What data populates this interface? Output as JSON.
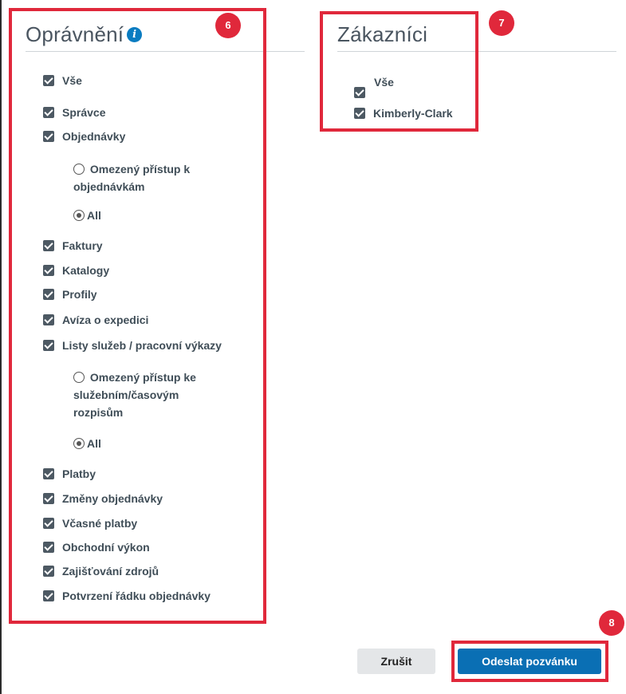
{
  "permissions": {
    "title": "Oprávnění",
    "badge": "6",
    "items": [
      {
        "type": "checkbox",
        "label": "Vše"
      },
      {
        "type": "checkbox",
        "label": "Správce"
      },
      {
        "type": "checkbox",
        "label": "Objednávky"
      },
      {
        "type": "radio",
        "label": "Omezený přístup k objednávkám",
        "lines": [
          "Omezený přístup k",
          "objednávkám"
        ],
        "checked": false
      },
      {
        "type": "radio",
        "label": "All",
        "checked": true
      },
      {
        "type": "checkbox",
        "label": "Faktury"
      },
      {
        "type": "checkbox",
        "label": "Katalogy"
      },
      {
        "type": "checkbox",
        "label": "Profily"
      },
      {
        "type": "checkbox",
        "label": "Avíza o expedici"
      },
      {
        "type": "checkbox",
        "label": "Listy služeb / pracovní výkazy"
      },
      {
        "type": "radio",
        "label": "Omezený přístup ke služebním/časovým rozpisům",
        "lines": [
          "Omezený přístup ke",
          "služebním/časovým",
          "rozpisům"
        ],
        "checked": false
      },
      {
        "type": "radio",
        "label": "All",
        "checked": true
      },
      {
        "type": "checkbox",
        "label": "Platby"
      },
      {
        "type": "checkbox",
        "label": "Změny objednávky"
      },
      {
        "type": "checkbox",
        "label": "Včasné platby"
      },
      {
        "type": "checkbox",
        "label": "Obchodní výkon"
      },
      {
        "type": "checkbox",
        "label": "Zajišťování zdrojů"
      },
      {
        "type": "checkbox",
        "label": "Potvrzení řádku objednávky"
      }
    ]
  },
  "customers": {
    "title": "Zákazníci",
    "badge": "7",
    "items": [
      {
        "label": "Vše"
      },
      {
        "label": "Kimberly-Clark"
      }
    ]
  },
  "actions": {
    "badge": "8",
    "cancel_label": "Zrušit",
    "submit_label": "Odeslat pozvánku"
  },
  "colors": {
    "highlight": "#e0283b",
    "primary": "#0a6fb4",
    "info": "#0a7cc1"
  }
}
